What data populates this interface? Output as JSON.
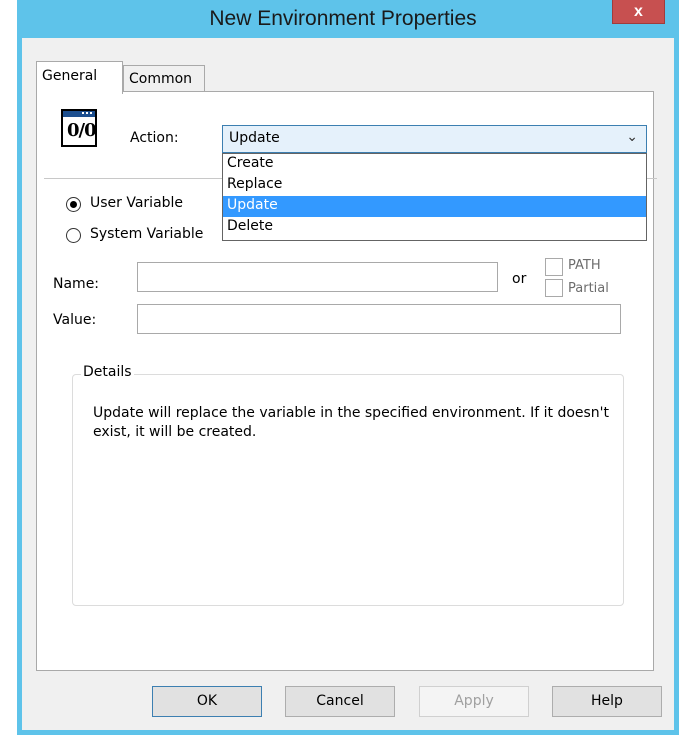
{
  "window": {
    "title": "New Environment Properties",
    "close_glyph": "x"
  },
  "tabs": [
    {
      "label": "General",
      "active": true
    },
    {
      "label": "Common",
      "active": false
    }
  ],
  "action": {
    "icon_glyph": "0/0",
    "label": "Action:",
    "selected": "Update",
    "options": [
      "Create",
      "Replace",
      "Update",
      "Delete"
    ],
    "highlighted_index": 2
  },
  "variable_type": {
    "user_label": "User Variable",
    "system_label": "System Variable",
    "selected": "user"
  },
  "fields": {
    "name_label": "Name:",
    "name_value": "",
    "or_label": "or",
    "path_label": "PATH",
    "partial_label": "Partial",
    "value_label": "Value:",
    "value_value": ""
  },
  "details": {
    "title": "Details",
    "text": "Update will replace the variable in the specified environment. If it doesn't exist, it will be created."
  },
  "buttons": {
    "ok": "OK",
    "cancel": "Cancel",
    "apply": "Apply",
    "help": "Help"
  },
  "colors": {
    "titlebar": "#5ec3ea",
    "close": "#c75050",
    "selection": "#3399ff"
  }
}
